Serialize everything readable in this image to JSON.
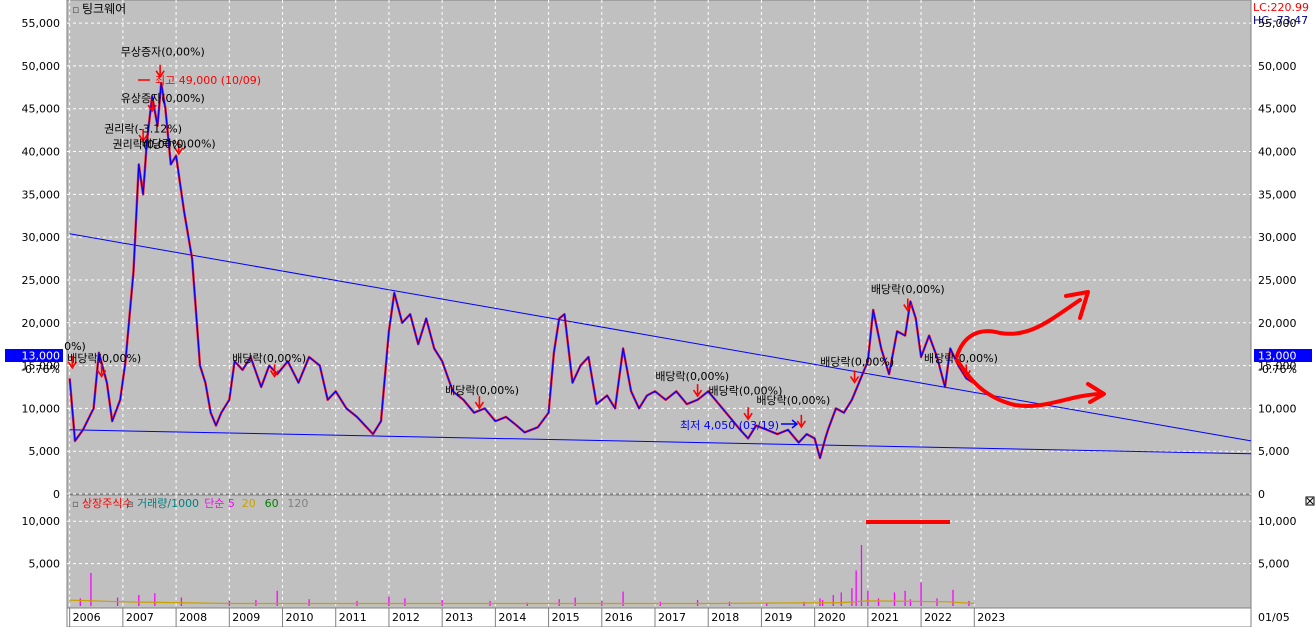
{
  "title": "팅크웨어",
  "top_right": {
    "lc": "LC:220.99",
    "hc": "HC:-73.47"
  },
  "current_price": {
    "value": "13,000",
    "change": "-0.76%"
  },
  "max_note": "최고 49,000 (10/09)",
  "min_note": "최저 4,050 (03/19)",
  "right_date": "01/05",
  "colors": {
    "panel_bg": "#c0c0c0",
    "price_line": "#0000ff",
    "price_up": "#ff0000",
    "trend_line": "#0000ff",
    "annotation": "#ff0000",
    "label_bg": "#0000ff"
  },
  "event_labels": [
    {
      "text": "무상증자(0,00%)",
      "x": 2007.75,
      "y": 51200
    },
    {
      "text": "유상증자(0,00%)",
      "x": 2007.75,
      "y": 45800
    },
    {
      "text": "권리락(-3.12%)",
      "x": 2007.38,
      "y": 42200
    },
    {
      "text": "배당락(0,00%)",
      "x": 2008.05,
      "y": 40500
    },
    {
      "text": "권리락(0,00%)",
      "x": 2007.5,
      "y": 40400
    },
    {
      "text": "배당락(0,00%)",
      "x": 2006.65,
      "y": 15400
    },
    {
      "text": "0%)",
      "x": 2006.1,
      "y": 16800
    },
    {
      "text": "배당락(0,00%)",
      "x": 2009.75,
      "y": 15400
    },
    {
      "text": "배당락(0,00%)",
      "x": 2013.75,
      "y": 11700
    },
    {
      "text": "배당락(0,00%)",
      "x": 2017.7,
      "y": 13300
    },
    {
      "text": "배당락(0,00%)",
      "x": 2018.7,
      "y": 11600
    },
    {
      "text": "배당락(0,00%)",
      "x": 2019.6,
      "y": 10500
    },
    {
      "text": "배당락(0,00%)",
      "x": 2020.8,
      "y": 15000
    },
    {
      "text": "배당락(0,00%)",
      "x": 2021.75,
      "y": 23500
    },
    {
      "text": "배당락(0,00%)",
      "x": 2022.75,
      "y": 15400
    }
  ],
  "volume_legend": [
    {
      "text": "상장주식수",
      "color": "#ff0000"
    },
    {
      "text": "거래량/1000",
      "color": "#008080"
    },
    {
      "text": "단순 5",
      "color": "#ff00ff"
    },
    {
      "text": "20",
      "color": "#c8a000"
    },
    {
      "text": "60",
      "color": "#008000"
    },
    {
      "text": "120",
      "color": "#808080"
    }
  ],
  "chart_data": {
    "type": "line",
    "price_axis": {
      "ticks": [
        0,
        5000,
        10000,
        15000,
        20000,
        25000,
        30000,
        35000,
        40000,
        45000,
        50000,
        55000
      ],
      "labels": [
        "0",
        "5,000",
        "10,000",
        "15,000",
        "20,000",
        "25,000",
        "30,000",
        "35,000",
        "40,000",
        "45,000",
        "50,000",
        "55,000"
      ],
      "ylim": [
        0,
        57000
      ]
    },
    "volume_axis": {
      "ticks": [
        5000,
        10000
      ],
      "labels": [
        "5,000",
        "10,000"
      ],
      "ylim": [
        0,
        12500
      ]
    },
    "x_axis": {
      "xlim": [
        2005.95,
        2028.2
      ],
      "ticks": [
        2006,
        2007,
        2008,
        2009,
        2010,
        2011,
        2012,
        2013,
        2014,
        2015,
        2016,
        2017,
        2018,
        2019,
        2020,
        2021,
        2022,
        2023
      ],
      "labels": [
        "2006",
        "2007",
        "2008",
        "2009",
        "2010",
        "2011",
        "2012",
        "2013",
        "2014",
        "2015",
        "2016",
        "2017",
        "2018",
        "2019",
        "2020",
        "2021",
        "2022",
        "2023"
      ]
    },
    "price_series": {
      "name": "팅크웨어",
      "x": [
        2006.0,
        2006.1,
        2006.25,
        2006.45,
        2006.55,
        2006.7,
        2006.8,
        2006.95,
        2007.05,
        2007.2,
        2007.3,
        2007.38,
        2007.45,
        2007.55,
        2007.65,
        2007.72,
        2007.8,
        2007.9,
        2008.0,
        2008.15,
        2008.3,
        2008.45,
        2008.55,
        2008.65,
        2008.75,
        2008.85,
        2009.0,
        2009.1,
        2009.25,
        2009.4,
        2009.6,
        2009.75,
        2009.9,
        2010.1,
        2010.3,
        2010.5,
        2010.7,
        2010.85,
        2011.0,
        2011.2,
        2011.4,
        2011.55,
        2011.7,
        2011.85,
        2012.0,
        2012.1,
        2012.25,
        2012.4,
        2012.55,
        2012.7,
        2012.85,
        2013.0,
        2013.2,
        2013.4,
        2013.6,
        2013.8,
        2014.0,
        2014.2,
        2014.4,
        2014.55,
        2014.8,
        2015.0,
        2015.1,
        2015.2,
        2015.3,
        2015.45,
        2015.6,
        2015.75,
        2015.9,
        2016.1,
        2016.25,
        2016.4,
        2016.55,
        2016.7,
        2016.85,
        2017.0,
        2017.2,
        2017.4,
        2017.6,
        2017.8,
        2018.0,
        2018.2,
        2018.4,
        2018.6,
        2018.75,
        2018.9,
        2019.1,
        2019.3,
        2019.5,
        2019.7,
        2019.85,
        2020.0,
        2020.1,
        2020.2,
        2020.25,
        2020.4,
        2020.55,
        2020.7,
        2020.8,
        2020.9,
        2021.0,
        2021.1,
        2021.25,
        2021.4,
        2021.55,
        2021.7,
        2021.8,
        2021.9,
        2022.0,
        2022.15,
        2022.3,
        2022.45,
        2022.55,
        2022.7,
        2022.85,
        2022.98
      ],
      "y": [
        13500,
        6200,
        7500,
        10000,
        16500,
        13000,
        8500,
        11000,
        15500,
        26000,
        38500,
        35000,
        41000,
        46500,
        43000,
        48000,
        45000,
        38500,
        39500,
        33000,
        27500,
        15000,
        13000,
        9500,
        8000,
        9500,
        11000,
        15500,
        14500,
        16000,
        12500,
        15000,
        14000,
        15500,
        13000,
        16000,
        15000,
        11000,
        12000,
        10000,
        9000,
        8000,
        7000,
        8500,
        19000,
        23500,
        20000,
        21000,
        17500,
        20500,
        17000,
        15500,
        12000,
        11000,
        9500,
        10000,
        8500,
        9000,
        8000,
        7200,
        7800,
        9500,
        16500,
        20500,
        21000,
        13000,
        15000,
        16000,
        10500,
        11500,
        10000,
        17000,
        12000,
        10000,
        11500,
        12000,
        11000,
        12000,
        10500,
        11000,
        12000,
        10500,
        9000,
        7500,
        6500,
        8000,
        7500,
        7000,
        7500,
        6000,
        7000,
        6500,
        4200,
        6500,
        7500,
        10000,
        9500,
        11000,
        12500,
        14000,
        15500,
        21500,
        17000,
        14000,
        19000,
        18500,
        22500,
        20500,
        16000,
        18500,
        16000,
        12500,
        17000,
        15000,
        13500,
        13000
      ]
    },
    "trend_lines": [
      {
        "x": [
          2006.0,
          2028.2
        ],
        "y": [
          30400,
          6200
        ]
      },
      {
        "x": [
          2006.0,
          2028.2
        ],
        "y": [
          7500,
          4700
        ]
      }
    ],
    "event_markers": [
      {
        "x": 2006.05,
        "y": 14500
      },
      {
        "x": 2006.6,
        "y": 13500
      },
      {
        "x": 2007.38,
        "y": 41000
      },
      {
        "x": 2007.55,
        "y": 44500
      },
      {
        "x": 2007.7,
        "y": 48500
      },
      {
        "x": 2008.05,
        "y": 39500
      },
      {
        "x": 2009.85,
        "y": 13500
      },
      {
        "x": 2013.7,
        "y": 9800
      },
      {
        "x": 2017.8,
        "y": 11200
      },
      {
        "x": 2018.75,
        "y": 8500
      },
      {
        "x": 2019.75,
        "y": 7600
      },
      {
        "x": 2020.75,
        "y": 12800
      },
      {
        "x": 2021.75,
        "y": 21200
      },
      {
        "x": 2022.85,
        "y": 13500
      }
    ],
    "volume_series": {
      "name": "거래량/1000",
      "x": [
        2006.2,
        2006.4,
        2006.9,
        2007.3,
        2007.6,
        2008.1,
        2009.0,
        2009.5,
        2009.9,
        2010.5,
        2011.4,
        2012.0,
        2012.3,
        2013.0,
        2013.9,
        2014.6,
        2015.2,
        2015.5,
        2016.0,
        2016.4,
        2017.1,
        2017.8,
        2018.4,
        2019.1,
        2019.8,
        2020.1,
        2020.15,
        2020.35,
        2020.5,
        2020.7,
        2020.78,
        2020.88,
        2021.0,
        2021.2,
        2021.5,
        2021.7,
        2021.8,
        2022.0,
        2022.3,
        2022.6,
        2022.9
      ],
      "y": [
        900,
        3900,
        1000,
        1300,
        1500,
        1000,
        600,
        700,
        1800,
        800,
        600,
        1100,
        900,
        700,
        600,
        400,
        800,
        1000,
        600,
        1700,
        500,
        700,
        500,
        400,
        500,
        900,
        700,
        1300,
        1600,
        2100,
        4200,
        7200,
        1800,
        900,
        1600,
        1800,
        800,
        2800,
        900,
        1900,
        600
      ]
    },
    "listed_shares_series": {
      "name": "상장주식수",
      "x": [
        2006.0,
        2007.0,
        2009.0,
        2012.0,
        2015.0,
        2018.0,
        2020.5,
        2021.0,
        2022.5,
        2023.0
      ],
      "y": [
        700,
        500,
        300,
        300,
        300,
        300,
        400,
        600,
        500,
        300
      ]
    }
  }
}
